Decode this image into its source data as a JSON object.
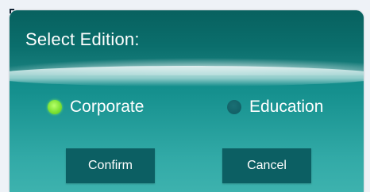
{
  "dialog": {
    "title": "Select Edition:",
    "options": [
      {
        "label": "Corporate",
        "selected": true
      },
      {
        "label": "Education",
        "selected": false
      }
    ],
    "buttons": {
      "confirm_label": "Confirm",
      "cancel_label": "Cancel"
    }
  },
  "colors": {
    "selected_radio": "#7ee335",
    "unselected_radio": "#0f5b61",
    "button_bg": "#0c5f63",
    "header_bg": "#0a6e6c"
  }
}
